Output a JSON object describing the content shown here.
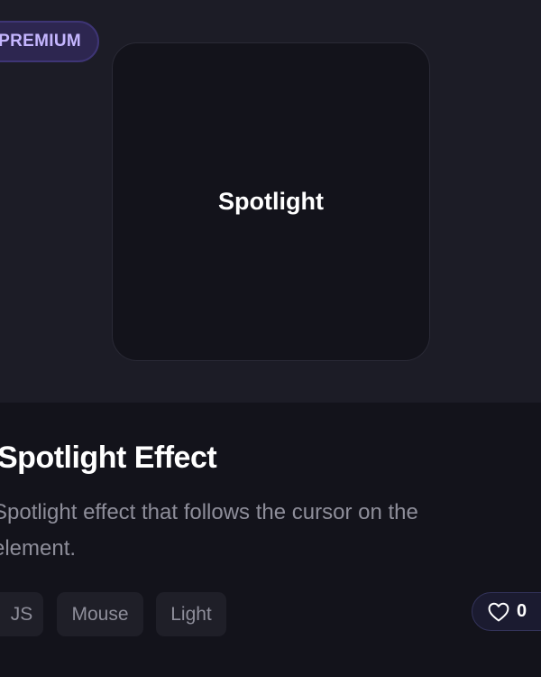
{
  "card": {
    "badge": "PREMIUM",
    "preview_label": "Spotlight",
    "title": "Spotlight Effect",
    "description": "Spotlight effect that follows the cursor on the element.",
    "tags": [
      {
        "label": "JS"
      },
      {
        "label": "Mouse"
      },
      {
        "label": "Light"
      }
    ],
    "likes": "0"
  },
  "icons": {
    "like": "heart-icon"
  },
  "colors": {
    "background": "#13131b",
    "preview_background": "#1c1c26",
    "badge_background": "#2d2650",
    "badge_text": "#c5b6ff",
    "muted_text": "#8e8e9a",
    "tag_background": "#1f1f28"
  }
}
